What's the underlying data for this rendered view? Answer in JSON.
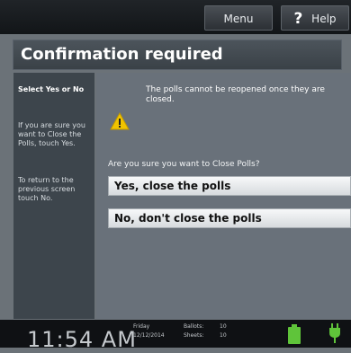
{
  "topbar": {
    "menu_label": "Menu",
    "help_icon": "question-mark-icon",
    "help_label": "Help"
  },
  "header": {
    "title": "Confirmation required"
  },
  "sidebar": {
    "heading": "Select Yes or No",
    "text1": "If you are sure you want to Close the Polls, touch Yes.",
    "text2": "To return to the previous screen touch No."
  },
  "main": {
    "warning_icon": "warning-triangle-icon",
    "warning_text": "The polls cannot be reopened once they are closed.",
    "question": "Are you sure you want to Close Polls?",
    "yes_label": "Yes, close the polls",
    "no_label": "No, don't close the polls"
  },
  "statusbar": {
    "time": "11:54 AM",
    "day": "Friday",
    "date": "12/12/2014",
    "ballots_label": "Ballots:",
    "ballots_value": "10",
    "sheets_label": "Sheets:",
    "sheets_value": "10",
    "battery_icon": "battery-icon",
    "plug_icon": "power-plug-icon"
  },
  "colors": {
    "warning": "#f2c400",
    "battery": "#5fc43a",
    "plug": "#5fc43a"
  }
}
